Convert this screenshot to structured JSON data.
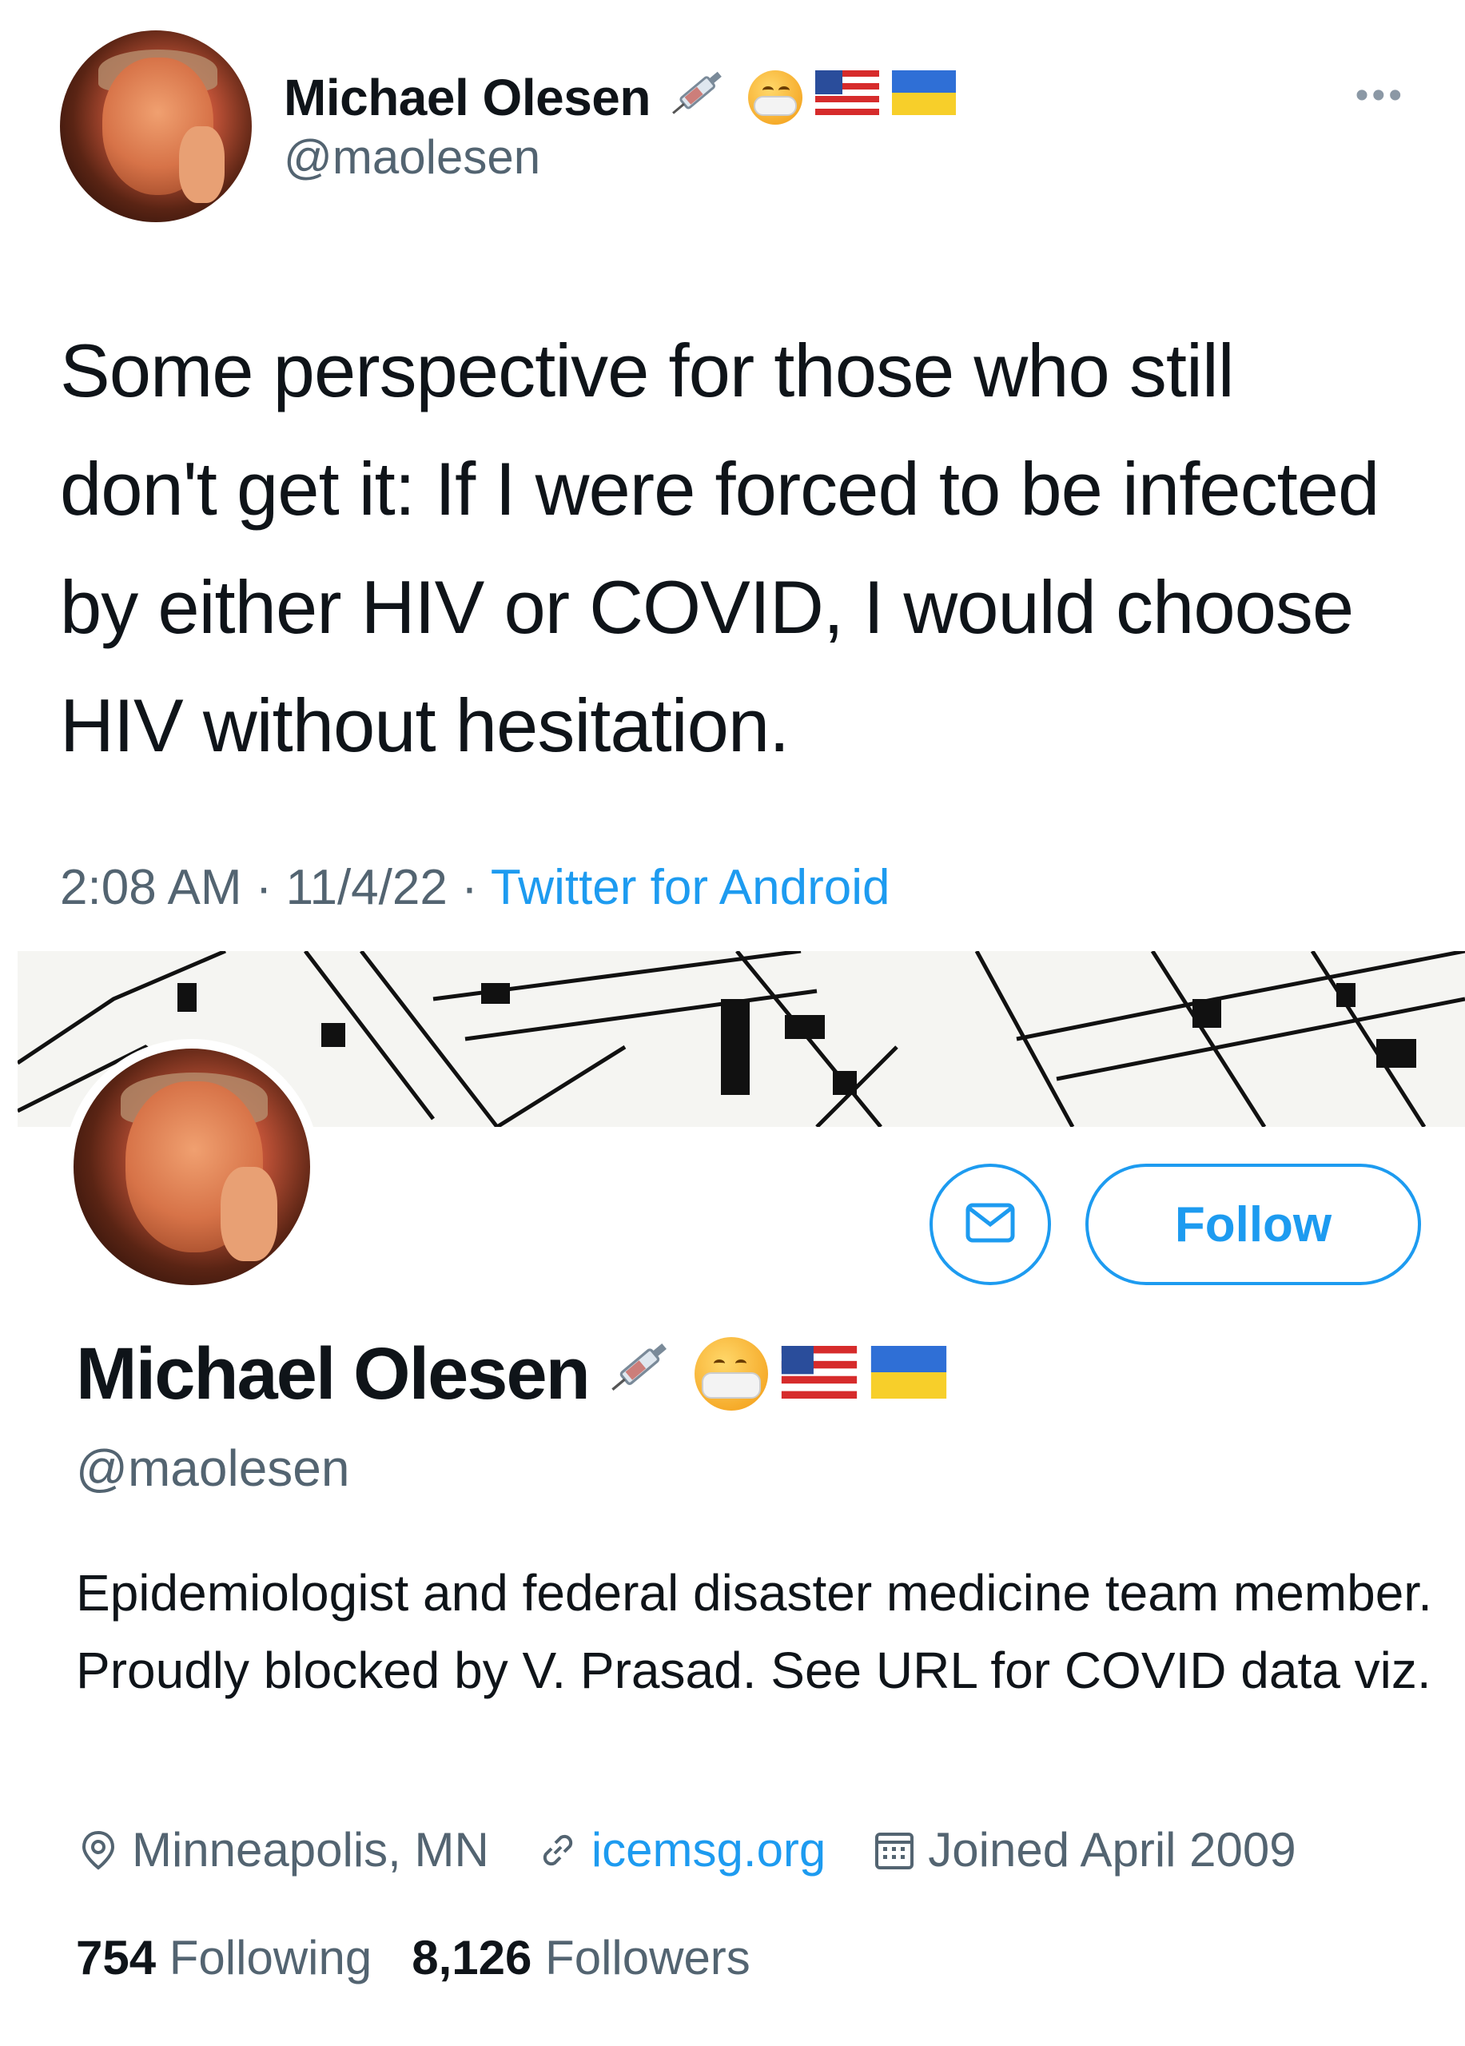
{
  "tweet": {
    "author_name": "Michael Olesen",
    "author_handle": "@maolesen",
    "more_label": "•••",
    "text": "Some perspective for those who still don't get it: If I were forced to be infected by either HIV or COVID, I would choose HIV without hesitation.",
    "time": "2:08 AM",
    "separator1": " · ",
    "date": "11/4/22",
    "separator2": " · ",
    "source": "Twitter for Android",
    "name_emojis": [
      "syringe-icon",
      "face-with-mask-icon",
      "us-flag-icon",
      "ukraine-flag-icon"
    ]
  },
  "profile": {
    "name": "Michael Olesen",
    "handle": "@maolesen",
    "follow_label": "Follow",
    "bio": "Epidemiologist and federal disaster medicine team member. Proudly blocked by V. Prasad. See URL for COVID data viz.",
    "location": "Minneapolis, MN",
    "url": "icemsg.org",
    "joined": "Joined April 2009",
    "following_count": "754",
    "following_label": " Following",
    "followers_count": "8,126",
    "followers_label": " Followers"
  },
  "colors": {
    "accent": "#1d9bf0",
    "secondary_text": "#536471",
    "primary_text": "#0f1419"
  }
}
